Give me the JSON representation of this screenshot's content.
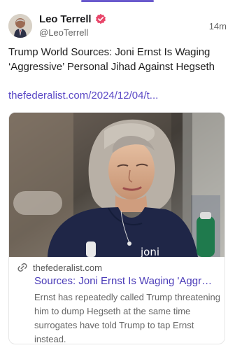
{
  "post": {
    "author_name": "Leo Terrell",
    "author_handle": "@LeoTerrell",
    "time": "14m",
    "text": "Trump World Sources: Joni Ernst Is Waging ‘Aggressive’ Personal Jihad Against Hegseth",
    "link_text": "thefederalist.com/2024/12/04/t..."
  },
  "card": {
    "domain": "thefederalist.com",
    "title": "Sources: Joni Ernst Is Waging 'Aggres...",
    "description": "Ernst has repeatedly called Trump threatening him to dump Hegseth at the same time surrogates have told Trump to tap Ernst instead.",
    "shirt_text": "joni"
  },
  "icons": {
    "verified": "verified-badge-icon",
    "link": "link-icon"
  },
  "colors": {
    "accent": "#5b49c6",
    "verified": "#e8466a",
    "card_title": "#4a3bb8",
    "secondary_text": "#666666"
  }
}
